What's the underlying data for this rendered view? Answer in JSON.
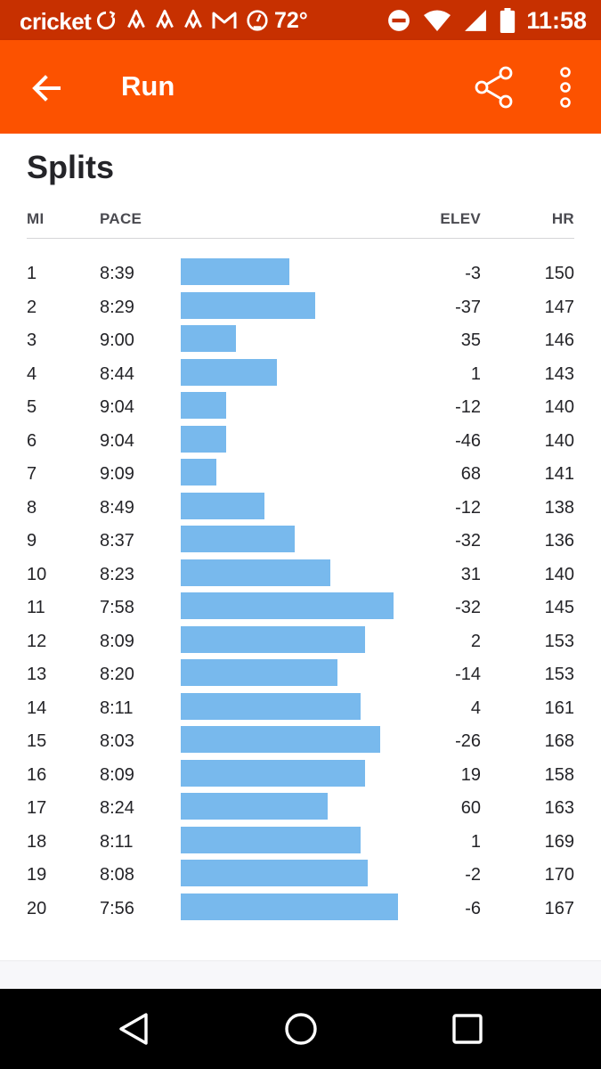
{
  "status_bar": {
    "carrier": "cricket",
    "temperature": "72°",
    "time": "11:58",
    "icons": [
      "sync-icon",
      "strava-icon",
      "strava-icon",
      "strava-icon",
      "gmail-icon",
      "speedometer-icon",
      "do-not-disturb-icon",
      "wifi-icon",
      "signal-icon",
      "battery-icon"
    ]
  },
  "app_bar": {
    "title": "Run",
    "background": "#fc5200",
    "icons": [
      "back-arrow-icon",
      "share-icon",
      "more-vert-icon"
    ]
  },
  "splits": {
    "title": "Splits",
    "headers": {
      "mi": "MI",
      "pace": "PACE",
      "elev": "ELEV",
      "hr": "HR"
    },
    "bar_color": "#78b9ed",
    "rows": [
      {
        "mi": "1",
        "pace": "8:39",
        "elev": "-3",
        "hr": "150"
      },
      {
        "mi": "2",
        "pace": "8:29",
        "elev": "-37",
        "hr": "147"
      },
      {
        "mi": "3",
        "pace": "9:00",
        "elev": "35",
        "hr": "146"
      },
      {
        "mi": "4",
        "pace": "8:44",
        "elev": "1",
        "hr": "143"
      },
      {
        "mi": "5",
        "pace": "9:04",
        "elev": "-12",
        "hr": "140"
      },
      {
        "mi": "6",
        "pace": "9:04",
        "elev": "-46",
        "hr": "140"
      },
      {
        "mi": "7",
        "pace": "9:09",
        "elev": "68",
        "hr": "141"
      },
      {
        "mi": "8",
        "pace": "8:49",
        "elev": "-12",
        "hr": "138"
      },
      {
        "mi": "9",
        "pace": "8:37",
        "elev": "-32",
        "hr": "136"
      },
      {
        "mi": "10",
        "pace": "8:23",
        "elev": "31",
        "hr": "140"
      },
      {
        "mi": "11",
        "pace": "7:58",
        "elev": "-32",
        "hr": "145"
      },
      {
        "mi": "12",
        "pace": "8:09",
        "elev": "2",
        "hr": "153"
      },
      {
        "mi": "13",
        "pace": "8:20",
        "elev": "-14",
        "hr": "153"
      },
      {
        "mi": "14",
        "pace": "8:11",
        "elev": "4",
        "hr": "161"
      },
      {
        "mi": "15",
        "pace": "8:03",
        "elev": "-26",
        "hr": "168"
      },
      {
        "mi": "16",
        "pace": "8:09",
        "elev": "19",
        "hr": "158"
      },
      {
        "mi": "17",
        "pace": "8:24",
        "elev": "60",
        "hr": "163"
      },
      {
        "mi": "18",
        "pace": "8:11",
        "elev": "1",
        "hr": "169"
      },
      {
        "mi": "19",
        "pace": "8:08",
        "elev": "-2",
        "hr": "170"
      },
      {
        "mi": "20",
        "pace": "7:56",
        "elev": "-6",
        "hr": "167"
      }
    ]
  },
  "nav_bar": {
    "icons": [
      "nav-back-icon",
      "nav-home-icon",
      "nav-recents-icon"
    ]
  }
}
